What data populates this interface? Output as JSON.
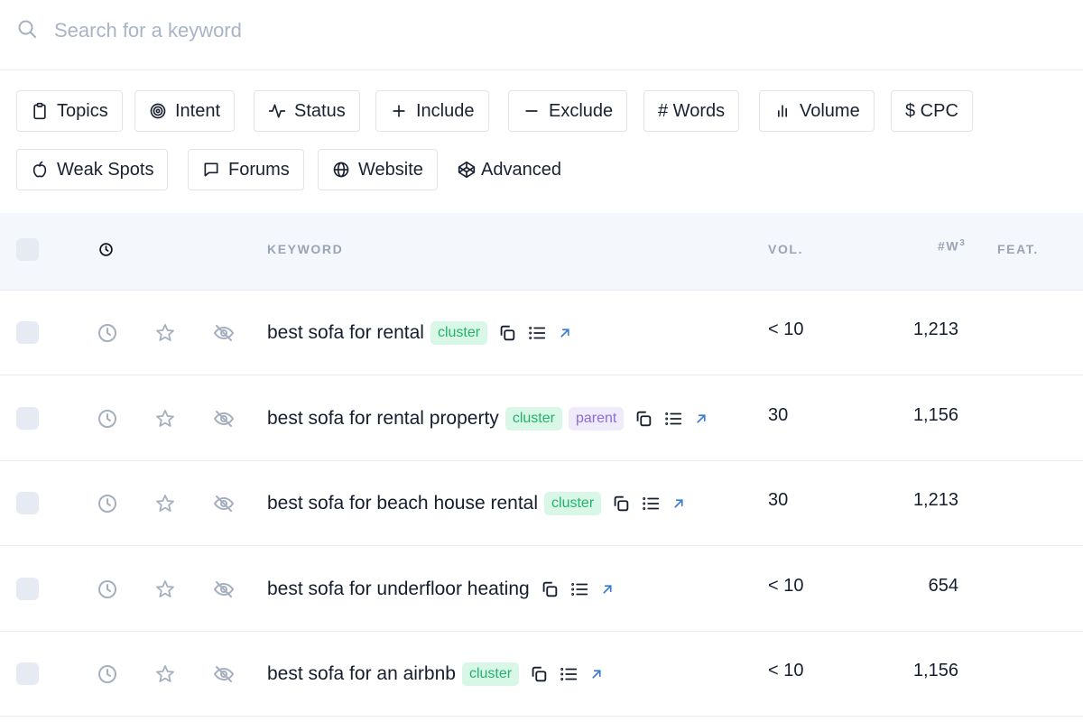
{
  "search": {
    "placeholder": "Search for a keyword",
    "value": ""
  },
  "filters": {
    "row1": [
      {
        "name": "topics",
        "label": "Topics",
        "icon": "clipboard-icon"
      },
      {
        "name": "intent",
        "label": "Intent",
        "icon": "target-icon"
      },
      {
        "name": "status",
        "label": "Status",
        "icon": "activity-icon"
      },
      {
        "name": "include",
        "label": "Include",
        "icon": "plus-icon"
      },
      {
        "name": "exclude",
        "label": "Exclude",
        "icon": "minus-icon"
      },
      {
        "name": "words",
        "label": "# Words",
        "icon": ""
      },
      {
        "name": "volume",
        "label": "Volume",
        "icon": "bar-chart-icon"
      },
      {
        "name": "cpc",
        "label": "$ CPC",
        "icon": ""
      }
    ],
    "row2": [
      {
        "name": "weak-spots",
        "label": "Weak Spots",
        "icon": "apple-icon"
      },
      {
        "name": "forums",
        "label": "Forums",
        "icon": "chat-icon"
      },
      {
        "name": "website",
        "label": "Website",
        "icon": "globe-icon"
      },
      {
        "name": "advanced",
        "label": "Advanced",
        "icon": "codepen-icon"
      }
    ]
  },
  "table": {
    "headers": {
      "keyword": "KEYWORD",
      "vol": "VOL.",
      "words": "#W",
      "words_sup": "3",
      "feat": "FEAT."
    },
    "rows": [
      {
        "keyword": "best sofa for rental",
        "tags": [
          "cluster"
        ],
        "vol": "< 10",
        "words": "1,213"
      },
      {
        "keyword": "best sofa for rental property",
        "tags": [
          "cluster",
          "parent"
        ],
        "vol": "30",
        "words": "1,156"
      },
      {
        "keyword": "best sofa for beach house rental",
        "tags": [
          "cluster"
        ],
        "vol": "30",
        "words": "1,213"
      },
      {
        "keyword": "best sofa for underfloor heating",
        "tags": [],
        "vol": "< 10",
        "words": "654"
      },
      {
        "keyword": "best sofa for an airbnb",
        "tags": [
          "cluster"
        ],
        "vol": "< 10",
        "words": "1,156"
      }
    ]
  },
  "colors": {
    "cluster_bg": "#d9f7e7",
    "cluster_text": "#23b26d",
    "parent_bg": "#efebfb",
    "parent_text": "#8b6cd9",
    "link_blue": "#3a7bd5",
    "icon_gray": "#a5afbf"
  }
}
